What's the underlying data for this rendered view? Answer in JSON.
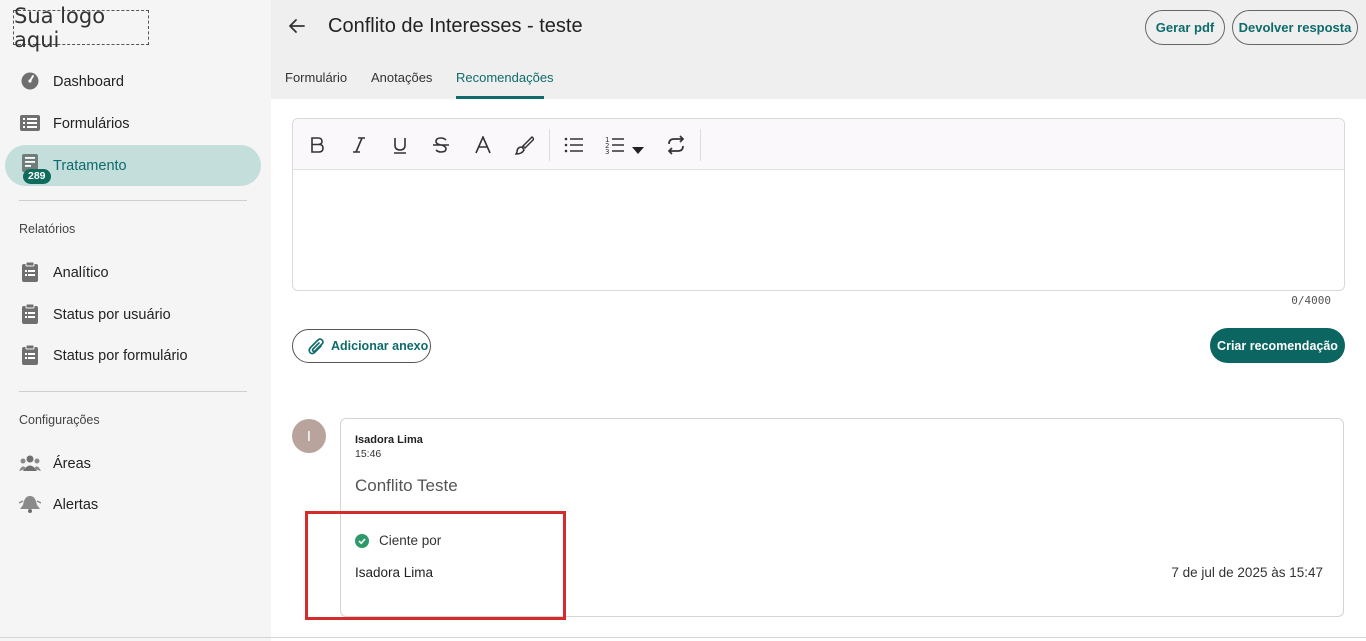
{
  "logo": {
    "text": "Sua logo aqui"
  },
  "sidebar": {
    "items": [
      {
        "label": "Dashboard",
        "icon": "gauge-icon"
      },
      {
        "label": "Formulários",
        "icon": "list-icon"
      },
      {
        "label": "Tratamento",
        "icon": "checklist-icon",
        "badge": "289",
        "active": true
      }
    ],
    "relatorios_title": "Relatórios",
    "relatorios": [
      {
        "label": "Analítico",
        "icon": "clipboard-icon"
      },
      {
        "label": "Status por usuário",
        "icon": "clipboard-icon"
      },
      {
        "label": "Status por formulário",
        "icon": "clipboard-icon"
      }
    ],
    "config_title": "Configurações",
    "config": [
      {
        "label": "Áreas",
        "icon": "people-icon"
      },
      {
        "label": "Alertas",
        "icon": "bell-icon"
      }
    ]
  },
  "header": {
    "title": "Conflito de Interesses - teste",
    "gerar_pdf": "Gerar pdf",
    "devolver": "Devolver resposta",
    "tabs": [
      {
        "label": "Formulário"
      },
      {
        "label": "Anotações"
      },
      {
        "label": "Recomendações",
        "active": true
      }
    ]
  },
  "editor": {
    "counter": "0/4000",
    "tools": [
      "bold-icon",
      "italic-icon",
      "underline-icon",
      "strikethrough-icon",
      "font-color-icon",
      "brush-icon",
      "bullet-list-icon",
      "numbered-list-icon",
      "chevron-down-icon",
      "repeat-icon"
    ]
  },
  "actions": {
    "attach": "Adicionar anexo",
    "create": "Criar recomendação"
  },
  "comment": {
    "avatar_initial": "I",
    "author": "Isadora Lima",
    "time": "15:46",
    "text": "Conflito Teste",
    "ciente_label": "Ciente por",
    "ciente_name": "Isadora Lima",
    "ciente_date": "7 de jul de 2025 às 15:47"
  },
  "colors": {
    "accent": "#0f6b6b",
    "active_bg": "#c4dedb",
    "badge": "#0f6b5c",
    "highlight": "#d52b2b",
    "check": "#2e9a6a"
  }
}
